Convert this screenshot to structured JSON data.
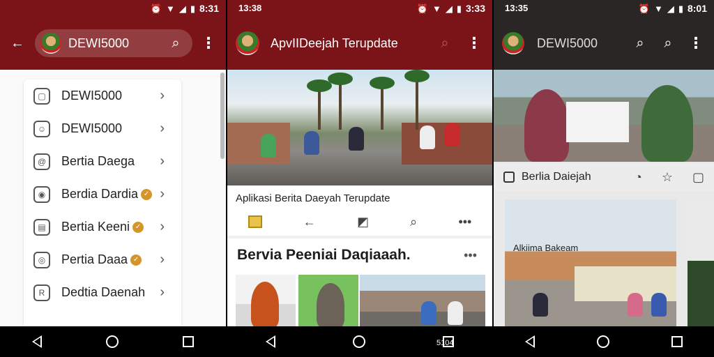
{
  "panel1": {
    "status": {
      "time": "8:31"
    },
    "search": {
      "text": "DEWI5000"
    },
    "list": [
      {
        "icon": "bag-icon",
        "label": "DEWI5000",
        "badge": false
      },
      {
        "icon": "emoji-icon",
        "label": "DEWI5000",
        "badge": false
      },
      {
        "icon": "at-icon",
        "label": "Bertia Daega",
        "badge": false
      },
      {
        "icon": "pin-icon",
        "label": "Berdia Dardia",
        "badge": true
      },
      {
        "icon": "photo-icon",
        "label": "Bertia Keeni",
        "badge": true
      },
      {
        "icon": "coin-icon",
        "label": "Pertia Daaa",
        "badge": true
      },
      {
        "icon": "book-icon",
        "label": "Dedtia Daenah",
        "badge": false
      }
    ]
  },
  "panel2": {
    "status": {
      "time_left": "13:38",
      "time_right": "3:33"
    },
    "title": "ApvIIDeejah Terupdate",
    "caption": "Aplikasi Berita Daeyah Terupdate",
    "section_title": "Bervia Peeniai Daqiaaah.",
    "nav_label": "5104"
  },
  "panel3": {
    "status": {
      "time_left": "13:35",
      "time_right": "8:01"
    },
    "title": "DEWI5000",
    "bar_label": "Berlia Daiejah",
    "card_caption": "Alkiima Bakeam"
  }
}
